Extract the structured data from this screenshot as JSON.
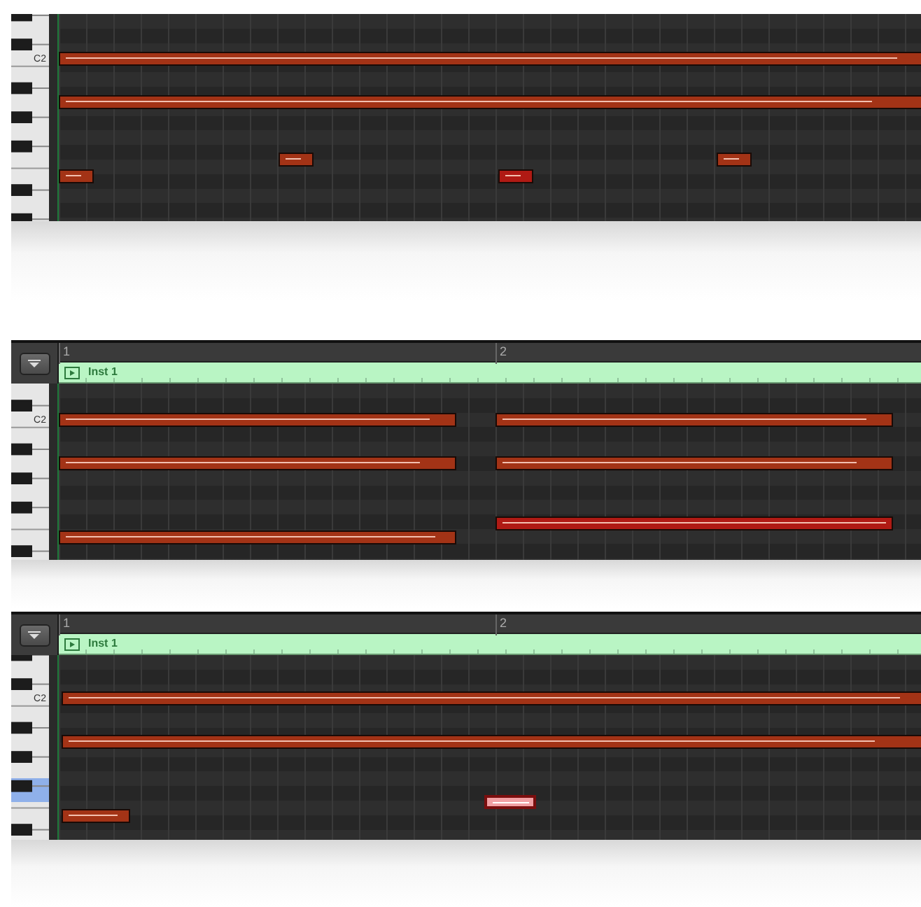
{
  "panels": [
    {
      "key_label": "C2",
      "highlighted_key": false,
      "notes": [
        {
          "kind": "normal"
        },
        {
          "kind": "normal"
        },
        {
          "kind": "normal"
        },
        {
          "kind": "normal"
        },
        {
          "kind": "normal"
        },
        {
          "kind": "accent"
        }
      ]
    },
    {
      "ruler": [
        "1",
        "2"
      ],
      "region": {
        "name": "Inst 1"
      },
      "key_label": "C2",
      "highlighted_key": false,
      "notes": [
        {
          "kind": "normal"
        },
        {
          "kind": "normal"
        },
        {
          "kind": "normal"
        },
        {
          "kind": "normal"
        },
        {
          "kind": "accent"
        },
        {
          "kind": "normal"
        }
      ]
    },
    {
      "ruler": [
        "1",
        "2"
      ],
      "region": {
        "name": "Inst 1"
      },
      "key_label": "C2",
      "highlighted_key": true,
      "notes": [
        {
          "kind": "normal"
        },
        {
          "kind": "normal"
        },
        {
          "kind": "selected"
        },
        {
          "kind": "normal"
        }
      ]
    }
  ]
}
